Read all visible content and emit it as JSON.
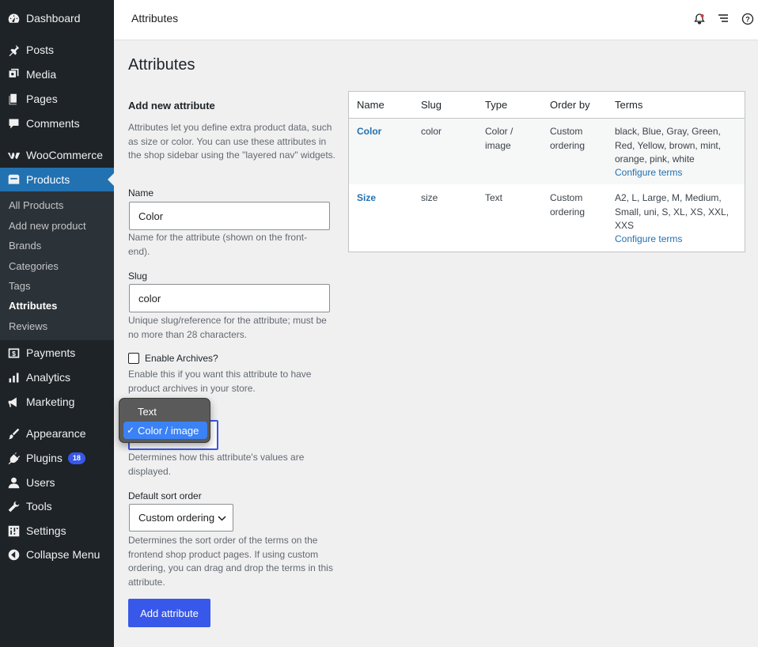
{
  "sidebar": {
    "items": [
      {
        "label": "Dashboard",
        "icon": "dashboard-icon"
      },
      {
        "label": "Posts",
        "icon": "pin-icon"
      },
      {
        "label": "Media",
        "icon": "media-icon"
      },
      {
        "label": "Pages",
        "icon": "pages-icon"
      },
      {
        "label": "Comments",
        "icon": "comment-icon"
      },
      {
        "label": "WooCommerce",
        "icon": "woocommerce-icon"
      },
      {
        "label": "Products",
        "icon": "products-icon"
      },
      {
        "label": "Payments",
        "icon": "payments-icon"
      },
      {
        "label": "Analytics",
        "icon": "analytics-icon"
      },
      {
        "label": "Marketing",
        "icon": "megaphone-icon"
      },
      {
        "label": "Appearance",
        "icon": "brush-icon"
      },
      {
        "label": "Plugins",
        "icon": "plugin-icon",
        "badge": "18"
      },
      {
        "label": "Users",
        "icon": "user-icon"
      },
      {
        "label": "Tools",
        "icon": "wrench-icon"
      },
      {
        "label": "Settings",
        "icon": "settings-icon"
      },
      {
        "label": "Collapse Menu",
        "icon": "collapse-icon"
      }
    ],
    "submenu": [
      "All Products",
      "Add new product",
      "Brands",
      "Categories",
      "Tags",
      "Attributes",
      "Reviews"
    ]
  },
  "header": {
    "title": "Attributes"
  },
  "page": {
    "title": "Attributes",
    "form_heading": "Add new attribute",
    "intro": "Attributes let you define extra product data, such as size or color. You can use these attributes in the shop sidebar using the \"layered nav\" widgets.",
    "name_label": "Name",
    "name_value": "Color",
    "name_help": "Name for the attribute (shown on the front-end).",
    "slug_label": "Slug",
    "slug_value": "color",
    "slug_help": "Unique slug/reference for the attribute; must be no more than 28 characters.",
    "archives_label": "Enable Archives?",
    "archives_help": "Enable this if you want this attribute to have product archives in your store.",
    "type_options": [
      "Text",
      "Color / image"
    ],
    "type_selected": "Color / image",
    "type_help": "Determines how this attribute's values are displayed.",
    "sort_label": "Default sort order",
    "sort_value": "Custom ordering",
    "sort_help": "Determines the sort order of the terms on the frontend shop product pages. If using custom ordering, you can drag and drop the terms in this attribute.",
    "add_button": "Add attribute"
  },
  "table": {
    "headers": [
      "Name",
      "Slug",
      "Type",
      "Order by",
      "Terms"
    ],
    "rows": [
      {
        "name": "Color",
        "slug": "color",
        "type": "Color / image",
        "order": "Custom ordering",
        "terms": "black, Blue, Gray, Green, Red, Yellow, brown, mint, orange, pink, white",
        "configure": "Configure terms"
      },
      {
        "name": "Size",
        "slug": "size",
        "type": "Text",
        "order": "Custom ordering",
        "terms": "A2, L, Large, M, Medium, Small, uni, S, XL, XS, XXL, XXS",
        "configure": "Configure terms"
      }
    ]
  },
  "colors": {
    "accent": "#3858e9",
    "sidebar_bg": "#1d2327",
    "active": "#2271b1",
    "link": "#2271b1"
  }
}
